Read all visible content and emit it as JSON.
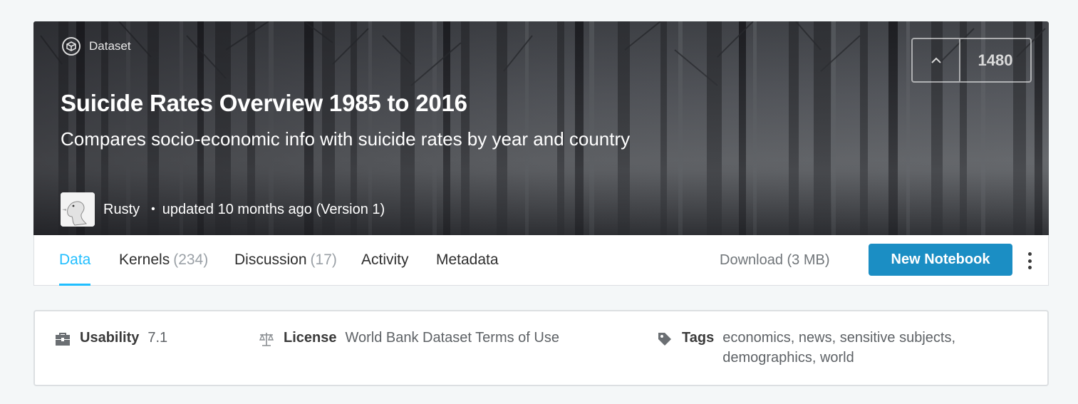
{
  "hero": {
    "type_label": "Dataset",
    "title": "Suicide Rates Overview 1985 to 2016",
    "subtitle": "Compares socio-economic info with suicide rates by year and country",
    "owner": "Rusty",
    "updated": "updated 10 months ago (Version 1)",
    "vote_count": "1480"
  },
  "tabs": [
    {
      "label": "Data",
      "count": ""
    },
    {
      "label": "Kernels",
      "count": "(234)"
    },
    {
      "label": "Discussion",
      "count": "(17)"
    },
    {
      "label": "Activity",
      "count": ""
    },
    {
      "label": "Metadata",
      "count": ""
    }
  ],
  "actions": {
    "download": "Download (3 MB)",
    "new_notebook": "New Notebook"
  },
  "info": {
    "usability_label": "Usability",
    "usability_value": "7.1",
    "license_label": "License",
    "license_value": "World Bank Dataset Terms of Use",
    "tags_label": "Tags",
    "tags_value": "economics, news, sensitive subjects, demographics, world"
  },
  "icons": {
    "dataset": "dataset-icon",
    "upvote": "chevron-up-icon",
    "more": "vertical-dots-icon",
    "usability": "toolbox-icon",
    "license": "scales-icon",
    "tags": "tag-icon"
  },
  "colors": {
    "accent": "#20beff",
    "button": "#1b8ec4",
    "page_background": "#f4f7f8"
  }
}
